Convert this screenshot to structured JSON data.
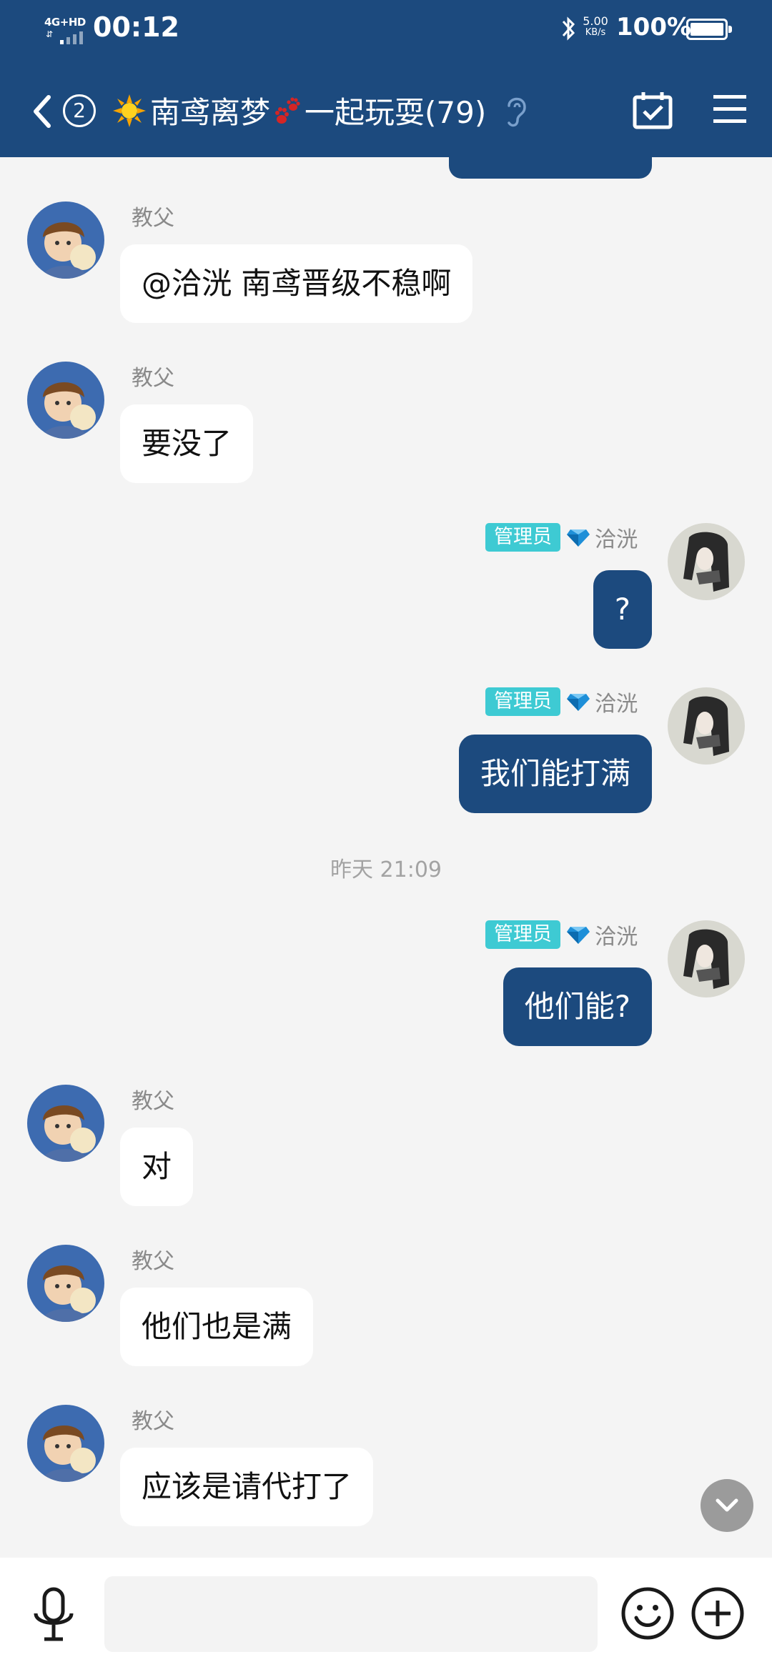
{
  "status_bar": {
    "network": "4G+HD",
    "time": "00:12",
    "speed_value": "5.00",
    "speed_unit": "KB/s",
    "battery": "100%"
  },
  "nav": {
    "unread_count": "2",
    "group_name": "南鸢离梦",
    "group_name_rest": "一起玩耍(79)"
  },
  "messages": [
    {
      "side": "in",
      "sender": "教父",
      "text": "@洽洸 南鸢晋级不稳啊"
    },
    {
      "side": "in",
      "sender": "教父",
      "text": "要没了"
    },
    {
      "side": "out",
      "role": "管理员",
      "sender": "洽洸",
      "text": "?"
    },
    {
      "side": "out",
      "role": "管理员",
      "sender": "洽洸",
      "text": "我们能打满"
    },
    {
      "timestamp": "昨天 21:09"
    },
    {
      "side": "out",
      "role": "管理员",
      "sender": "洽洸",
      "text": "他们能?"
    },
    {
      "side": "in",
      "sender": "教父",
      "text": "对"
    },
    {
      "side": "in",
      "sender": "教父",
      "text": "他们也是满"
    },
    {
      "side": "in",
      "sender": "教父",
      "text": "应该是请代打了"
    }
  ],
  "input": {
    "value": "",
    "placeholder": ""
  },
  "colors": {
    "header": "#1c4a7e",
    "outgoing_bubble": "#1c4a7e",
    "role_badge": "#3ecad3",
    "background": "#f4f4f4"
  },
  "icons": [
    "back-arrow-icon",
    "sun-emoji-icon",
    "paw-emoji-icon",
    "ear-icon",
    "calendar-check-icon",
    "menu-icon",
    "voice-mic-icon",
    "emoji-icon",
    "plus-icon",
    "chevron-down-icon",
    "diamond-icon",
    "bluetooth-icon"
  ]
}
